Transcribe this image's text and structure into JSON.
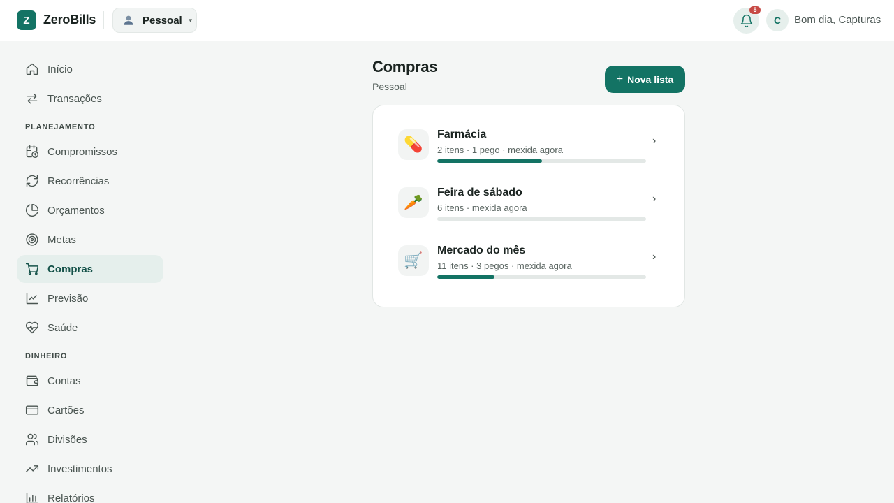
{
  "app": {
    "logo_letter": "Z",
    "name": "ZeroBills"
  },
  "profile_selector": {
    "label": "Pessoal"
  },
  "header": {
    "notifications_count": "5",
    "avatar_letter": "C",
    "greeting": "Bom dia, Capturas"
  },
  "sidebar": {
    "top_items": [
      {
        "label": "Início",
        "icon": "home-icon"
      },
      {
        "label": "Transações",
        "icon": "transfer-arrows-icon"
      }
    ],
    "sections": [
      {
        "title": "PLANEJAMENTO",
        "items": [
          {
            "label": "Compromissos",
            "icon": "calendar-clock-icon"
          },
          {
            "label": "Recorrências",
            "icon": "refresh-icon"
          },
          {
            "label": "Orçamentos",
            "icon": "pie-chart-icon"
          },
          {
            "label": "Metas",
            "icon": "target-icon"
          },
          {
            "label": "Compras",
            "icon": "cart-icon",
            "active": true
          },
          {
            "label": "Previsão",
            "icon": "line-chart-icon"
          },
          {
            "label": "Saúde",
            "icon": "heart-pulse-icon"
          }
        ]
      },
      {
        "title": "DINHEIRO",
        "items": [
          {
            "label": "Contas",
            "icon": "wallet-icon"
          },
          {
            "label": "Cartões",
            "icon": "credit-card-icon"
          },
          {
            "label": "Divisões",
            "icon": "users-icon"
          },
          {
            "label": "Investimentos",
            "icon": "trending-up-icon"
          },
          {
            "label": "Relatórios",
            "icon": "bar-chart-icon"
          }
        ]
      }
    ]
  },
  "main": {
    "title": "Compras",
    "subtitle": "Pessoal",
    "new_list_button": {
      "label": "Nova lista",
      "icon": "plus-icon"
    },
    "lists": [
      {
        "emoji": "💊",
        "name": "Farmácia",
        "meta": "2 itens · 1 pego · mexida agora",
        "progress": 0.5
      },
      {
        "emoji": "🥕",
        "name": "Feira de sábado",
        "meta": "6 itens · mexida agora",
        "progress": 0
      },
      {
        "emoji": "🛒",
        "name": "Mercado do mês",
        "meta": "11 itens · 3 pegos · mexida agora",
        "progress": 0.2727
      }
    ]
  },
  "colors": {
    "brand": "#137364",
    "active_bg": "#e5efec",
    "badge": "#c74a45",
    "background": "#f4f6f5"
  }
}
